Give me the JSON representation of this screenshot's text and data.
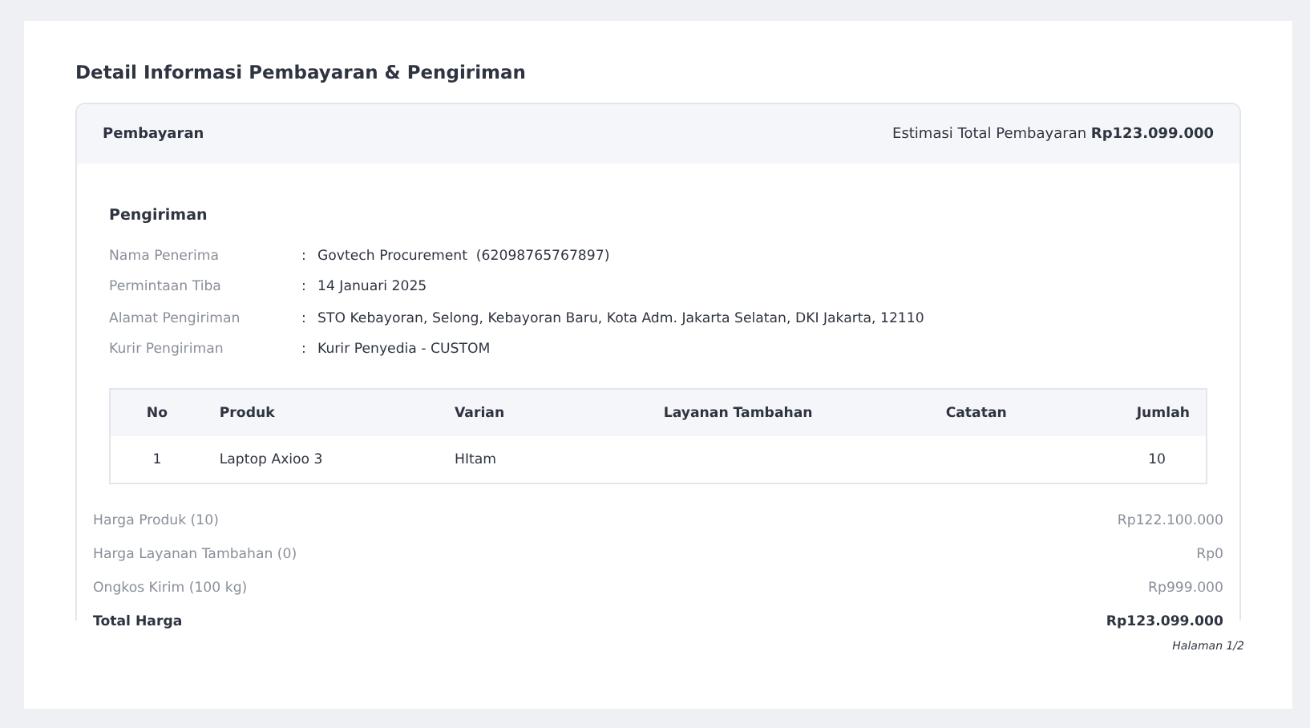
{
  "title": "Detail Informasi Pembayaran & Pengiriman",
  "payment": {
    "label": "Pembayaran",
    "estimate_label": "Estimasi Total Pembayaran",
    "estimate_value": "Rp123.099.000"
  },
  "shipping": {
    "heading": "Pengiriman",
    "fields": [
      {
        "label": "Nama Penerima",
        "separator": ":",
        "value": "Govtech Procurement  (62098765767897)"
      },
      {
        "label": "Permintaan Tiba",
        "separator": ":",
        "value": "14 Januari 2025"
      },
      {
        "label": "Alamat Pengiriman",
        "separator": ":",
        "value": "STO Kebayoran, Selong, Kebayoran Baru, Kota Adm. Jakarta Selatan, DKI Jakarta, 12110"
      },
      {
        "label": "Kurir Pengiriman",
        "separator": ":",
        "value": "Kurir Penyedia - CUSTOM"
      }
    ]
  },
  "table": {
    "columns": [
      "No",
      "Produk",
      "Varian",
      "Layanan Tambahan",
      "Catatan",
      "Jumlah"
    ],
    "rows": [
      [
        "1",
        "Laptop Axioo 3",
        "HItam",
        "",
        "",
        "10"
      ]
    ]
  },
  "summary": [
    {
      "kind": "item",
      "label": "Harga Produk (10)",
      "value": "Rp122.100.000"
    },
    {
      "kind": "item",
      "label": "Harga Layanan Tambahan (0)",
      "value": "Rp0"
    },
    {
      "kind": "item",
      "label": "Ongkos Kirim (100 kg)",
      "value": "Rp999.000"
    },
    {
      "kind": "total",
      "label": "Total Harga",
      "value": "Rp123.099.000"
    }
  ],
  "page_label": "Halaman 1/2"
}
